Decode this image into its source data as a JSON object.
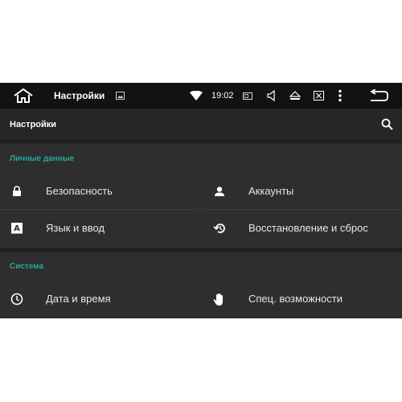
{
  "status_bar": {
    "title": "Настройки",
    "time": "19:02"
  },
  "action_bar": {
    "title": "Настройки"
  },
  "sections": [
    {
      "header": "Личные данные",
      "items": [
        {
          "label": "Безопасность",
          "icon": "lock-icon"
        },
        {
          "label": "Аккаунты",
          "icon": "account-icon"
        },
        {
          "label": "Язык и ввод",
          "icon": "language-icon"
        },
        {
          "label": "Восстановление и сброс",
          "icon": "restore-icon"
        }
      ]
    },
    {
      "header": "Система",
      "items": [
        {
          "label": "Дата и время",
          "icon": "clock-icon"
        },
        {
          "label": "Спец. возможности",
          "icon": "hand-icon"
        }
      ]
    }
  ],
  "colors": {
    "accent": "#26a69a",
    "background": "#2e2e2e",
    "status_bar": "#121212"
  }
}
